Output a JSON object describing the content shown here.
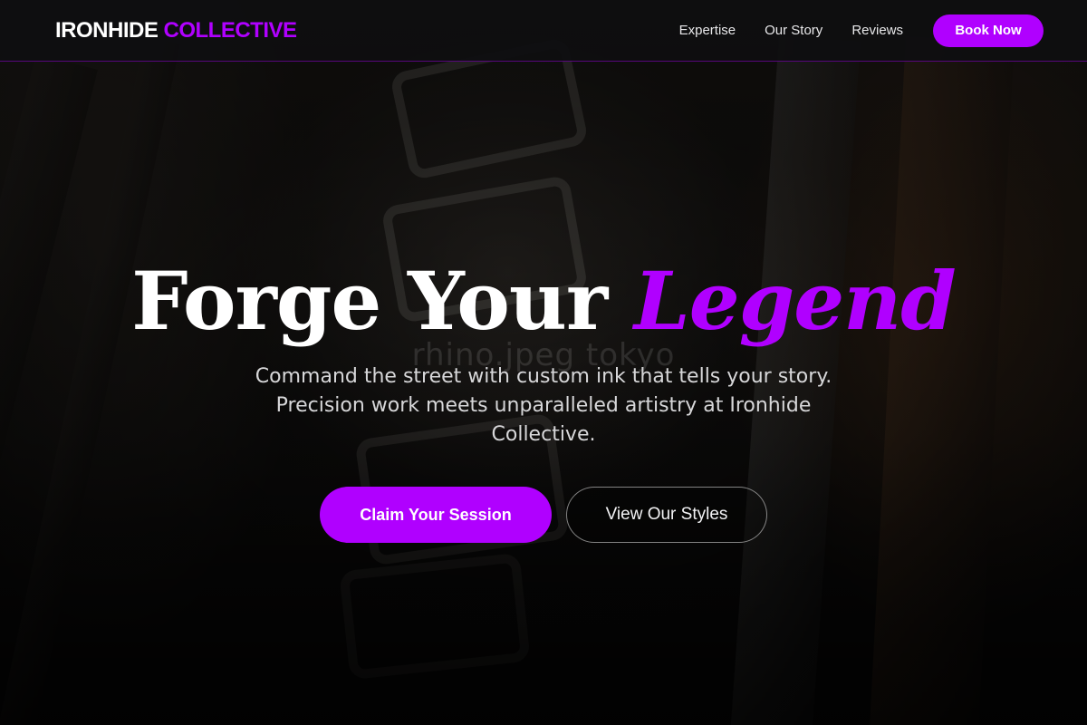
{
  "brand": {
    "name_part1": "IRONHIDE",
    "name_part2": "COLLECTIVE"
  },
  "nav": {
    "links": [
      {
        "label": "Expertise"
      },
      {
        "label": "Our Story"
      },
      {
        "label": "Reviews"
      }
    ],
    "cta_label": "Book Now"
  },
  "hero": {
    "headline_part1": "Forge Your",
    "headline_part2": "Legend",
    "watermark": "rhino.jpeg tokyo",
    "subtitle": "Command the street with custom ink that tells your story. Precision work meets unparalleled artistry at Ironhide Collective.",
    "primary_cta": "Claim Your Session",
    "secondary_cta": "View Our Styles"
  },
  "colors": {
    "accent": "#b000ff",
    "header_bg": "#0e0e10",
    "text": "#ffffff"
  }
}
